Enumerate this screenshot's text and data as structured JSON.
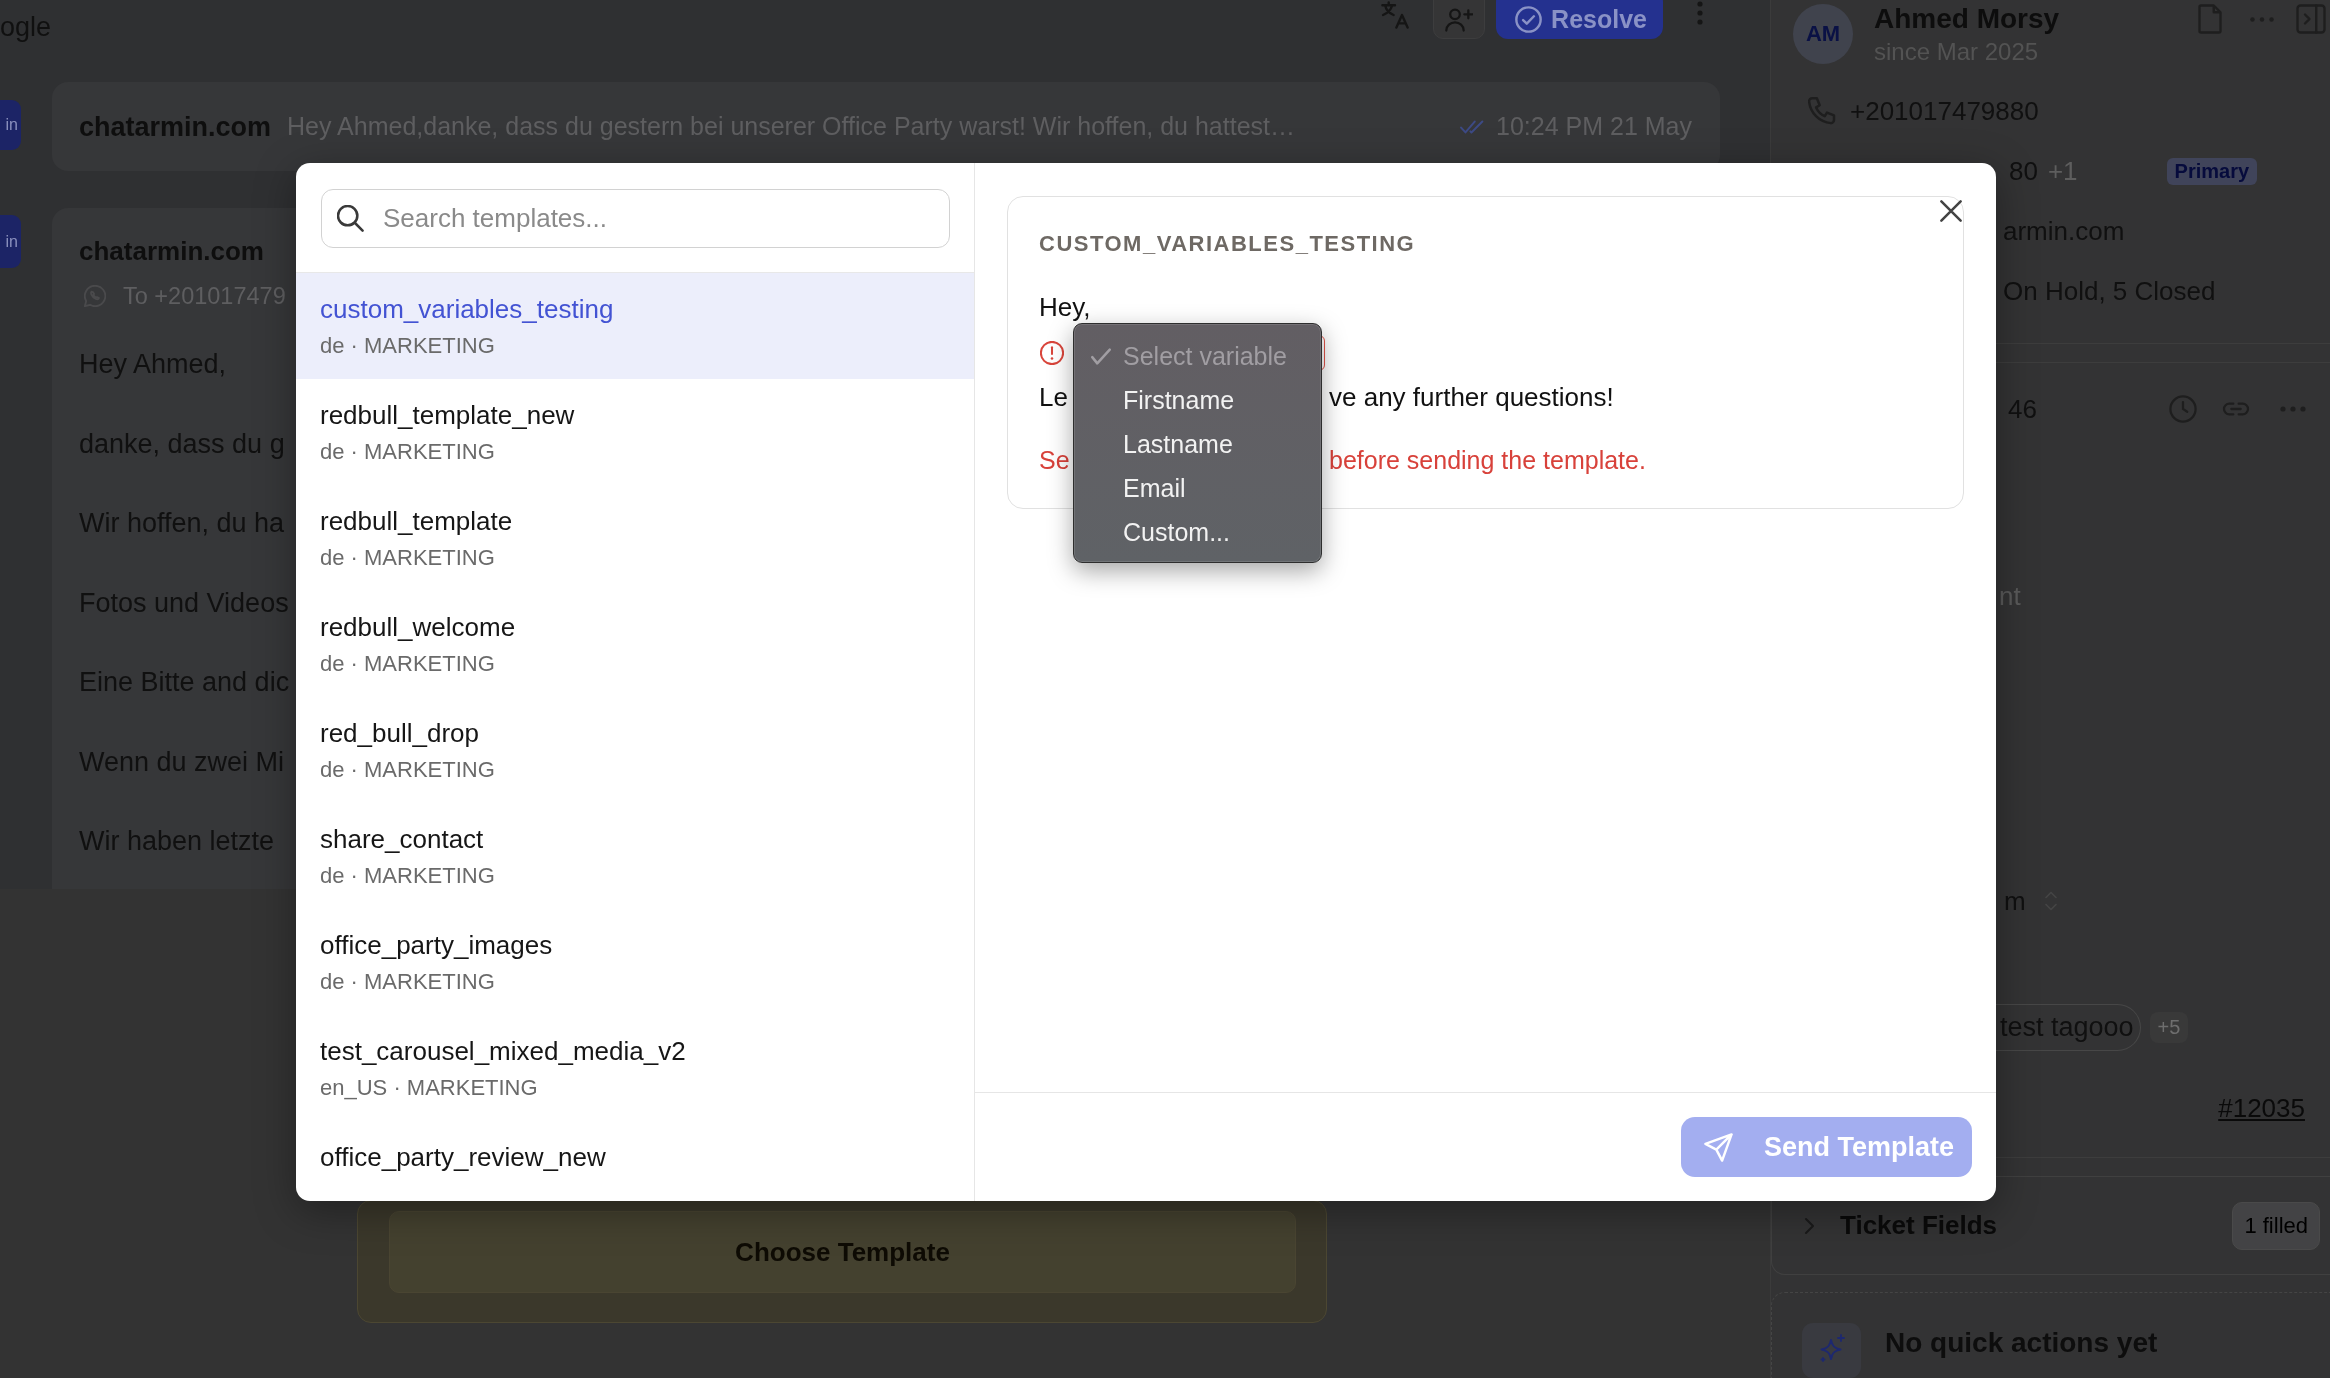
{
  "header": {
    "title_fragment": "ogle",
    "resolve_button": {
      "label": "Resolve"
    }
  },
  "conversation": {
    "preview": {
      "badge": "in",
      "sender": "chatarmin.com",
      "text": "Hey Ahmed,danke, dass du gestern bei unserer Office Party warst! Wir hoffen, du hattest…",
      "time": "10:24 PM 21 May"
    },
    "message": {
      "badge": "in",
      "sender": "chatarmin.com",
      "recipient": "To +201017479",
      "paragraphs": [
        "Hey Ahmed,",
        "danke, dass du g",
        "Wir hoffen, du ha",
        "Fotos und Videos",
        "Eine Bitte and dic",
        "Wenn du zwei Mi",
        "Wir haben letzte"
      ]
    }
  },
  "composer": {
    "choose_template_button": "Choose Template"
  },
  "contact_panel": {
    "initials": "AM",
    "name": "Ahmed Morsy",
    "since": "since Mar 2025",
    "phone": "+201017479880",
    "whatsapp_number": "80",
    "whatsapp_extra": "+1",
    "primary_badge": "Primary",
    "email": "armin.com",
    "tickets_summary": "On Hold, 5 Closed"
  },
  "ticket_panel": {
    "ticket_number": "46",
    "field_hint": "nt",
    "inbox": "m",
    "tags": [
      "test tagooo"
    ],
    "more_tags": "+5",
    "link": "#12035",
    "ticket_fields": {
      "title": "Ticket Fields",
      "badge": "1 filled",
      "expanded": false
    },
    "quick_actions": {
      "title": "No quick actions yet"
    }
  },
  "template_modal": {
    "search": {
      "placeholder": "Search templates..."
    },
    "templates": [
      {
        "name": "custom_variables_testing",
        "meta": "de · MARKETING",
        "selected": true
      },
      {
        "name": "redbull_template_new",
        "meta": "de · MARKETING",
        "selected": false
      },
      {
        "name": "redbull_template",
        "meta": "de · MARKETING",
        "selected": false
      },
      {
        "name": "redbull_welcome",
        "meta": "de · MARKETING",
        "selected": false
      },
      {
        "name": "red_bull_drop",
        "meta": "de · MARKETING",
        "selected": false
      },
      {
        "name": "share_contact",
        "meta": "de · MARKETING",
        "selected": false
      },
      {
        "name": "office_party_images",
        "meta": "de · MARKETING",
        "selected": false
      },
      {
        "name": "test_carousel_mixed_media_v2",
        "meta": "en_US · MARKETING",
        "selected": false
      },
      {
        "name": "office_party_review_new",
        "selected": false
      }
    ],
    "preview": {
      "title": "CUSTOM_VARIABLES_TESTING",
      "greeting": "Hey,",
      "text_before": "Le",
      "text_after": "ve any further questions!",
      "error_before": "Se",
      "error_after": "before sending the template."
    },
    "variable_select": {
      "invalid": true
    },
    "variable_menu": {
      "options": [
        {
          "label": "Select variable",
          "selected": true,
          "disabled": true
        },
        {
          "label": "Firstname",
          "selected": false,
          "disabled": false
        },
        {
          "label": "Lastname",
          "selected": false,
          "disabled": false
        },
        {
          "label": "Email",
          "selected": false,
          "disabled": false
        },
        {
          "label": "Custom...",
          "selected": false,
          "disabled": false
        }
      ]
    },
    "send_button": {
      "label": "Send Template",
      "disabled": true
    }
  }
}
